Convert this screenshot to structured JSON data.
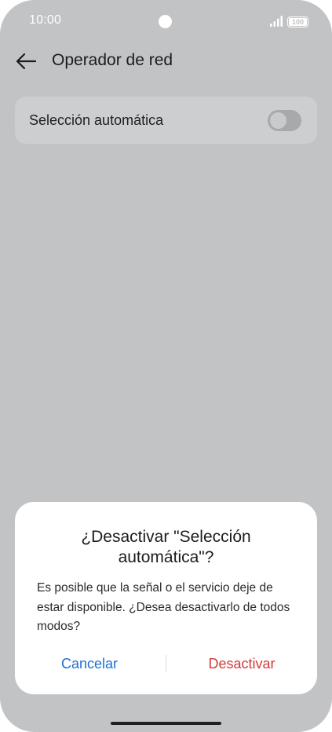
{
  "status_bar": {
    "time": "10:00",
    "battery": "100",
    "icons": [
      "camera-cutout",
      "signal-icon",
      "battery-icon"
    ]
  },
  "header": {
    "back_icon": "arrow-left-icon",
    "title": "Operador de red"
  },
  "settings": {
    "auto_selection": {
      "label": "Selección automática",
      "enabled": false
    }
  },
  "dialog": {
    "title": "¿Desactivar \"Selección automática\"?",
    "message": "Es posible que la señal o el servicio deje de estar disponible. ¿Desea desactivarlo de todos modos?",
    "cancel_label": "Cancelar",
    "confirm_label": "Desactivar"
  },
  "colors": {
    "scrim": "#c2c3c5",
    "cancel": "#1f6fd1",
    "confirm": "#d6393a"
  }
}
